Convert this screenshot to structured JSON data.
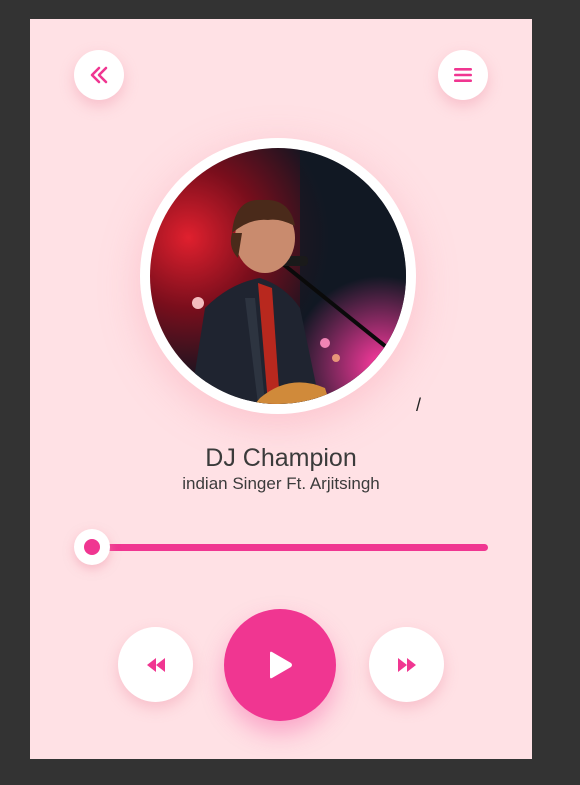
{
  "theme": {
    "accent": "#f03691",
    "background": "#ffe1e5",
    "frame": "#333333"
  },
  "header": {
    "back_icon": "double-chevron-left-icon",
    "menu_icon": "hamburger-menu-icon"
  },
  "track": {
    "title": "DJ Champion",
    "artist": "indian Singer Ft. Arjitsingh",
    "time_separator": "/",
    "progress": 0.0
  },
  "controls": {
    "rewind_icon": "rewind-icon",
    "play_icon": "play-icon",
    "forward_icon": "fast-forward-icon"
  }
}
